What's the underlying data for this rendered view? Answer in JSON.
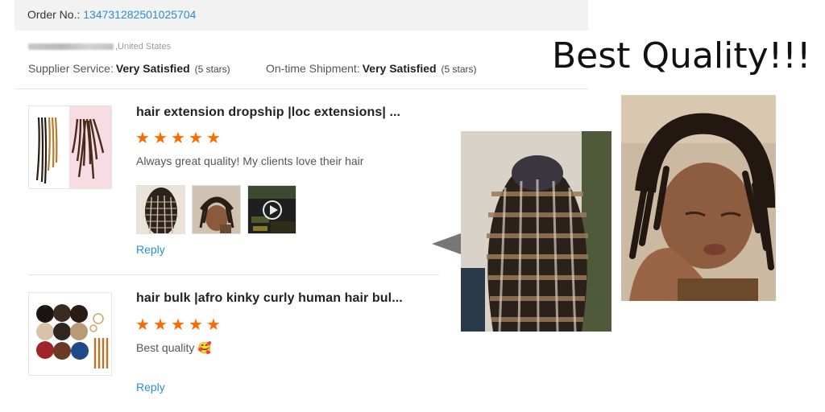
{
  "order": {
    "label": "Order No.:",
    "number": "134731282501025704"
  },
  "buyer": {
    "country": ",United States"
  },
  "ratings": {
    "supplier_service": {
      "label": "Supplier Service:",
      "value": "Very Satisfied",
      "stars_note": "(5 stars)"
    },
    "shipment": {
      "label": "On-time Shipment:",
      "value": "Very Satisfied",
      "stars_note": "(5 stars)"
    }
  },
  "reviews": [
    {
      "title": "hair extension dropship |loc extensions| ...",
      "rating": 5,
      "text": "Always great quality! My clients love their hair",
      "reply": "Reply",
      "photos": [
        "braids-photo",
        "child-locs-photo",
        "video-thumbnail"
      ]
    },
    {
      "title": "hair bulk |afro kinky curly human hair bul...",
      "rating": 5,
      "text": "Best quality 🥰",
      "reply": "Reply"
    }
  ],
  "headline": "Best Quality!!!",
  "icons": {
    "star": "star-icon",
    "play": "play-icon",
    "arrow": "arrow-left-icon"
  },
  "colors": {
    "link": "#2a8fd0",
    "star": "#ff6a00",
    "order_bar": "#f2f2f2"
  }
}
